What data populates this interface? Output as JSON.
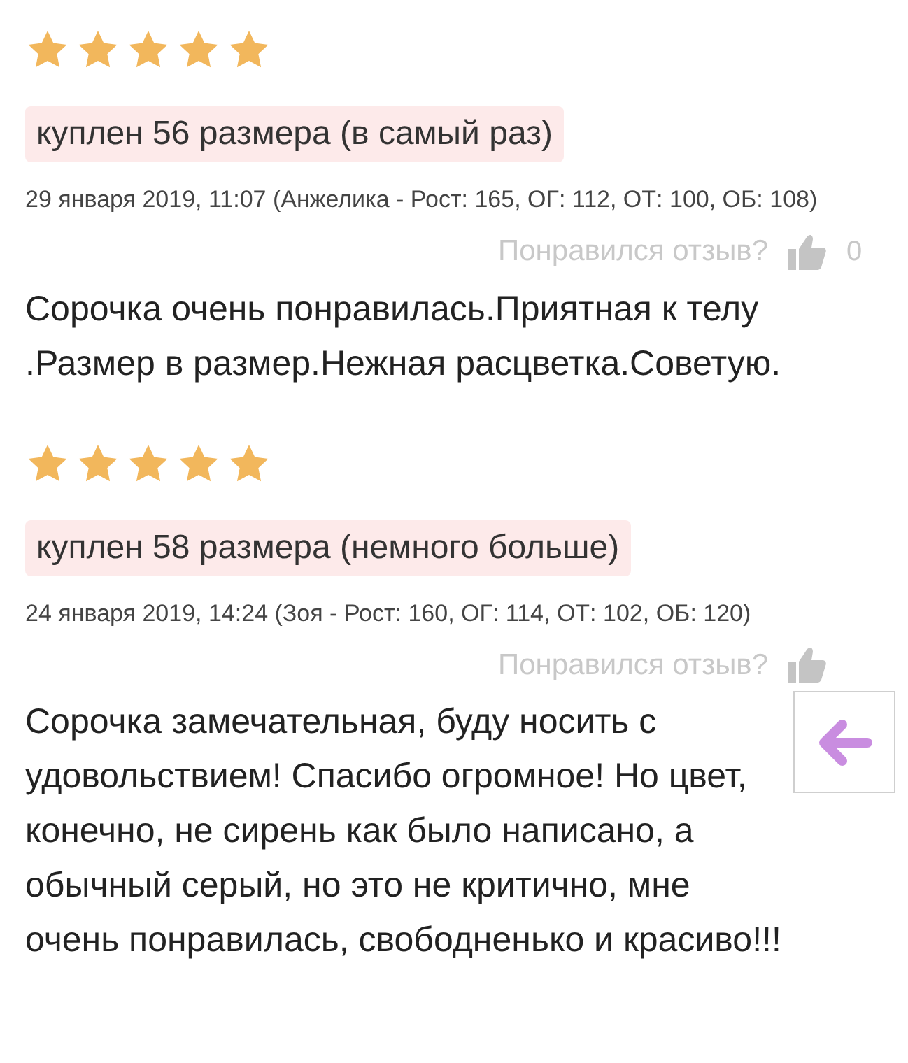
{
  "reviews": [
    {
      "stars": 5,
      "size_tag": "куплен 56 размера (в самый раз)",
      "meta": "29 января 2019, 11:07 (Анжелика - Рост: 165, ОГ: 112, ОТ: 100, ОБ: 108)",
      "like_prompt": "Понравился отзыв?",
      "like_count": "0",
      "text": "Сорочка очень понравилась.Приятная к телу .Размер в размер.Нежная расцветка.Советую."
    },
    {
      "stars": 5,
      "size_tag": "куплен 58 размера (немного больше)",
      "meta": "24 января 2019, 14:24 (Зоя - Рост: 160, ОГ: 114, ОТ: 102, ОБ: 120)",
      "like_prompt": "Понравился отзыв?",
      "text": "Сорочка замечательная, буду носить с удовольствием! Спасибо огромное! Но цвет, конечно, не сирень как было написано, а обычный серый, но это не критично, мне очень понравилась, свободненько и красиво!!!"
    }
  ]
}
